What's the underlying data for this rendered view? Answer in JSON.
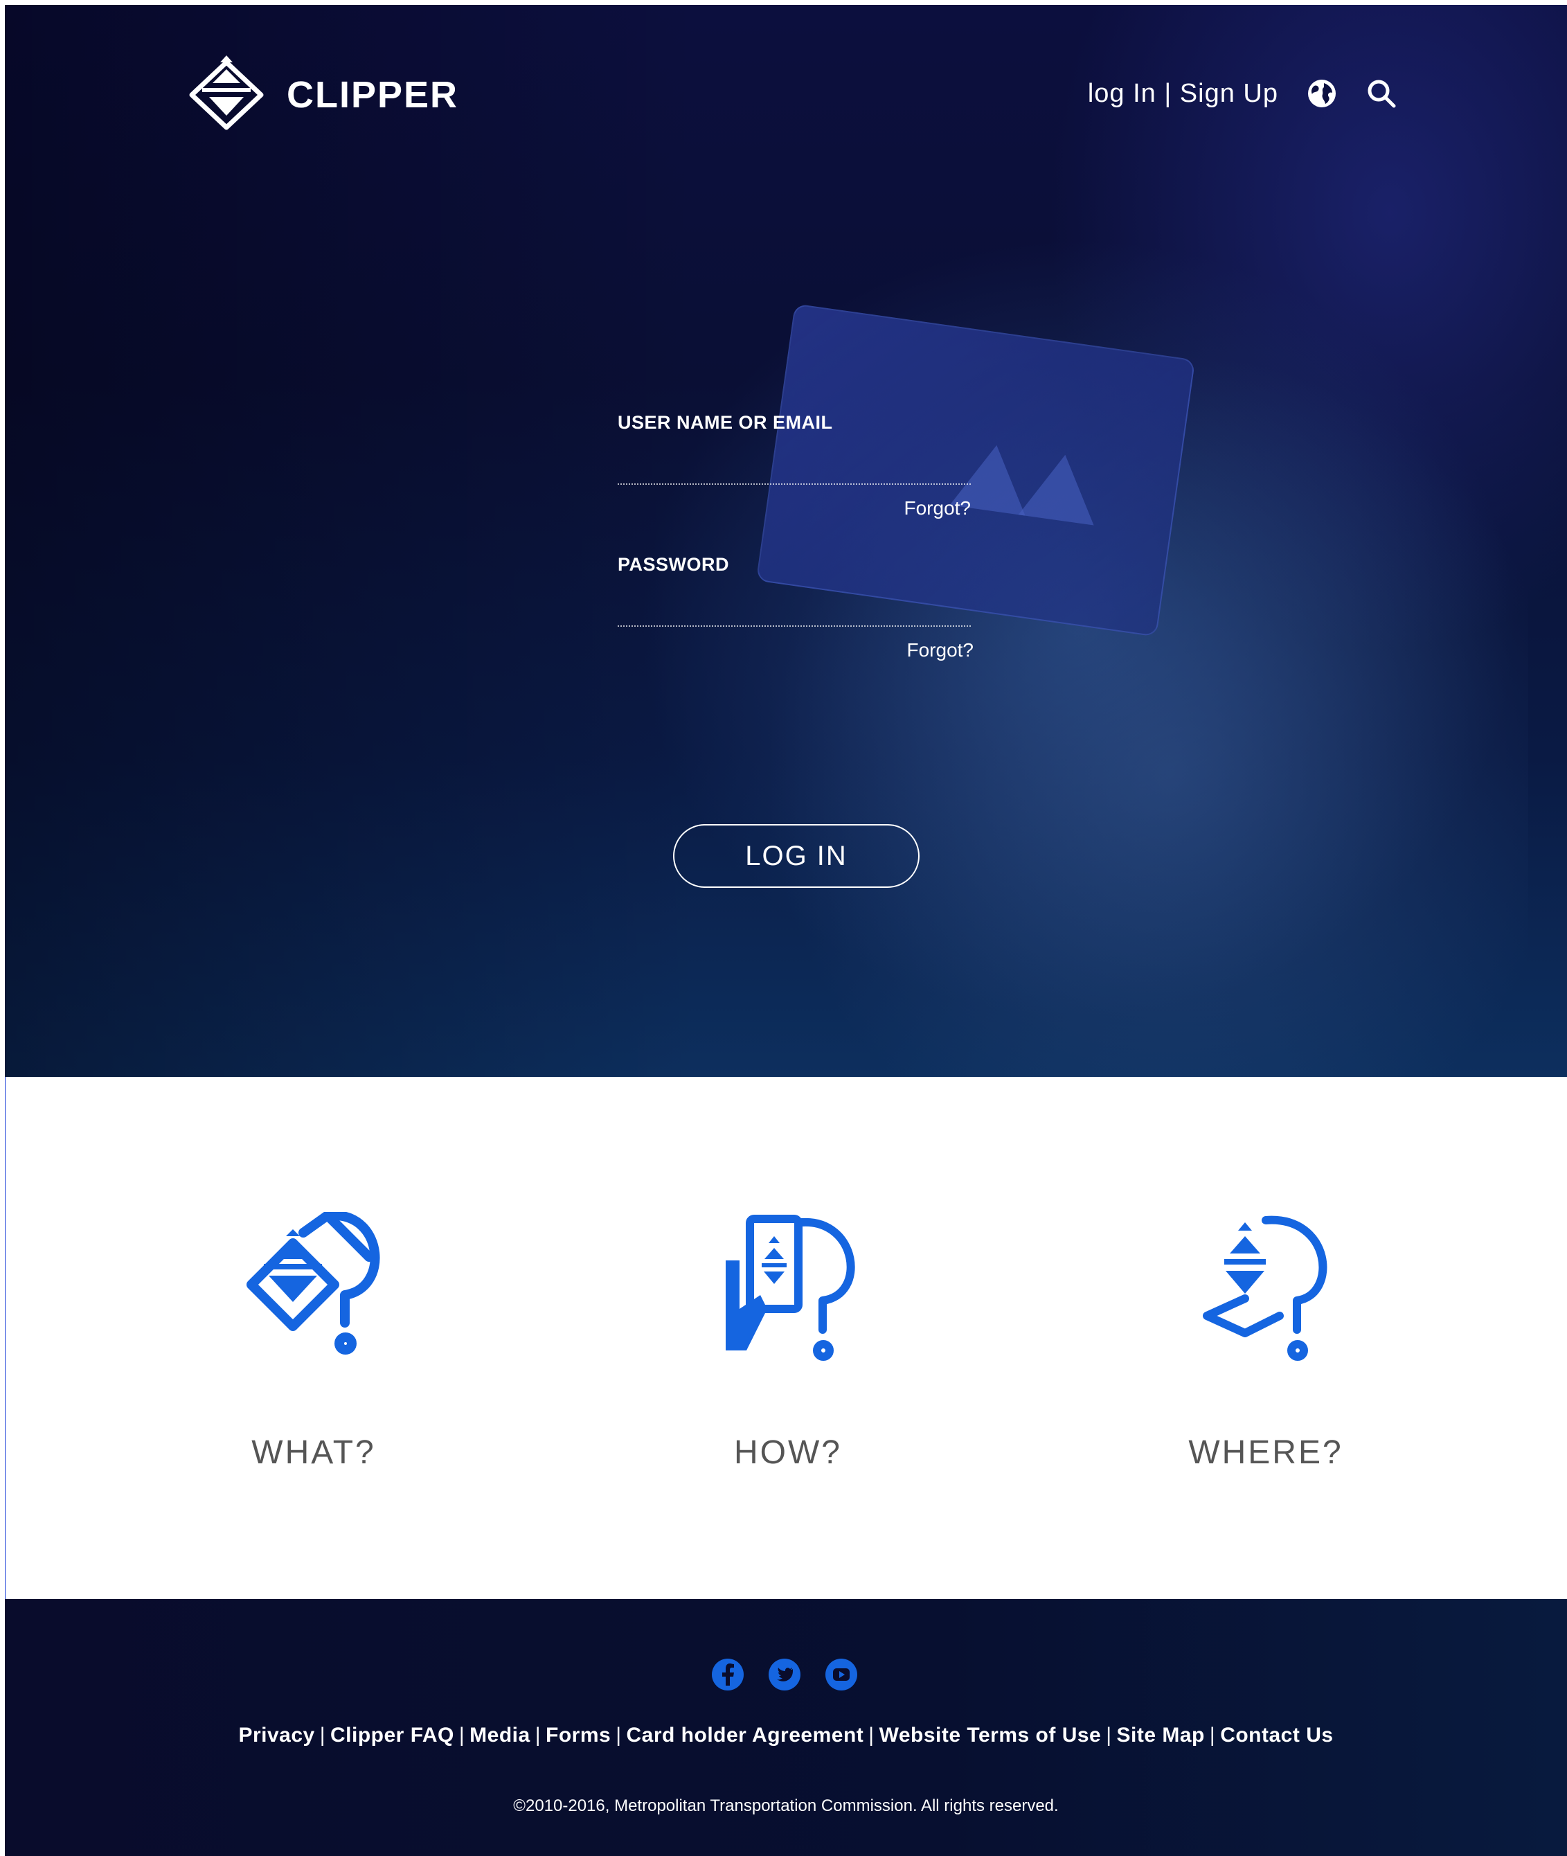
{
  "brand": {
    "name": "CLIPPER"
  },
  "topnav": {
    "login_label": "log In",
    "separator": "|",
    "signup_label": "Sign Up"
  },
  "login_form": {
    "username_label": "USER NAME OR EMAIL",
    "username_value": "",
    "forgot_username": "Forgot?",
    "password_label": "PASSWORD",
    "password_value": "",
    "forgot_password": "Forgot?",
    "submit_label": "LOG IN"
  },
  "features": [
    {
      "title": "WHAT?",
      "icon": "card-question-icon"
    },
    {
      "title": "HOW?",
      "icon": "hand-card-question-icon"
    },
    {
      "title": "WHERE?",
      "icon": "location-question-icon"
    }
  ],
  "footer": {
    "social": [
      "facebook-icon",
      "twitter-icon",
      "youtube-icon"
    ],
    "links": [
      "Privacy",
      "Clipper FAQ",
      "Media",
      "Forms",
      "Card holder Agreement",
      "Website Terms of Use",
      "Site Map",
      "Contact Us"
    ],
    "link_separator": "|",
    "copyright": "©2010-2016, Metropolitan Transportation Commission. All rights reserved."
  },
  "colors": {
    "accent": "#1565e0",
    "hero_dark": "#0a0f35",
    "footer_dark": "#090c2c",
    "feature_title": "#555555"
  }
}
